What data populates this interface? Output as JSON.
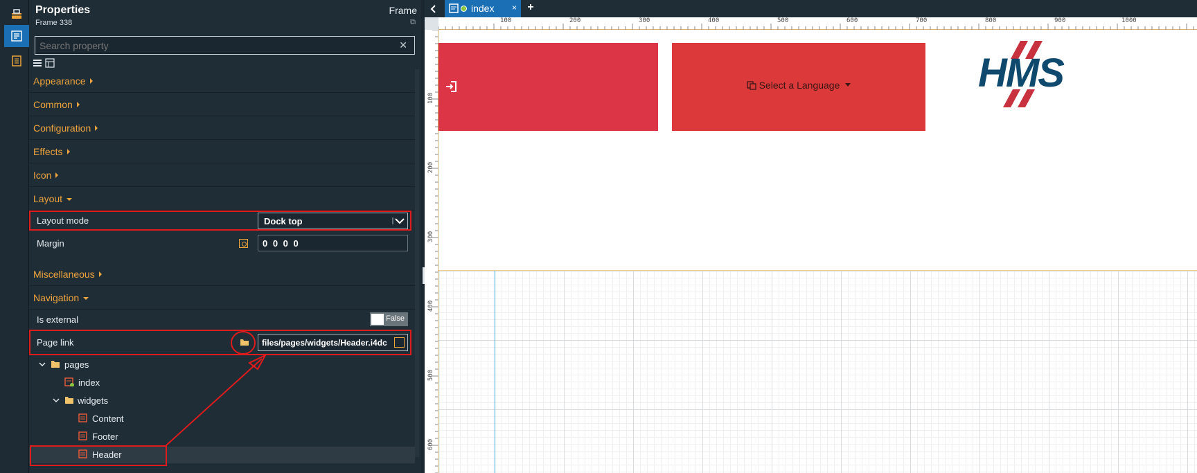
{
  "toolstrip": {
    "items": [
      "toolbox-icon",
      "properties-icon",
      "pages-icon"
    ]
  },
  "panel": {
    "title": "Properties",
    "subtitle": "Frame 338",
    "type": "Frame",
    "search_placeholder": "Search property",
    "categories": {
      "appearance": "Appearance",
      "common": "Common",
      "configuration": "Configuration",
      "effects": "Effects",
      "icon": "Icon",
      "layout": "Layout",
      "miscellaneous": "Miscellaneous",
      "navigation": "Navigation"
    },
    "layout_mode": {
      "label": "Layout mode",
      "value": "Dock top"
    },
    "margin": {
      "label": "Margin",
      "value": "0 0 0 0"
    },
    "is_external": {
      "label": "Is external",
      "value": "False"
    },
    "page_link": {
      "label": "Page link",
      "value": "files/pages/widgets/Header.i4dc"
    },
    "tree": {
      "pages": "pages",
      "index": "index",
      "widgets": "widgets",
      "content": "Content",
      "footer": "Footer",
      "header": "Header"
    }
  },
  "editor": {
    "tab_label": "index",
    "tab_close": "×",
    "tab_add": "+",
    "ruler_top": [
      "100",
      "200",
      "300",
      "400",
      "500",
      "600",
      "700",
      "800",
      "900",
      "1000"
    ],
    "ruler_left": [
      "100",
      "200",
      "300",
      "400",
      "500",
      "600"
    ],
    "language_button": "Select a Language",
    "logo_text": "HMS"
  },
  "colors": {
    "accent": "#1a6fb5",
    "category": "#f0a43c",
    "annotation": "#e01b1b",
    "header_red": "#dc3545",
    "logo_blue": "#0f4a6e",
    "logo_red": "#c8313e"
  }
}
